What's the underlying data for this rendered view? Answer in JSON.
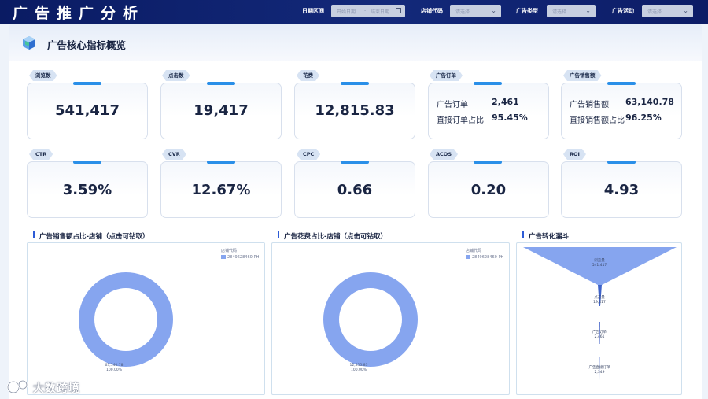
{
  "app_title": "广告推广分析",
  "filters": {
    "date_label": "日期区间",
    "date_start_placeholder": "开始日期",
    "date_sep": "-",
    "date_end_placeholder": "结束日期",
    "shop_label": "店铺代码",
    "shop_placeholder": "请选择",
    "adtype_label": "广告类型",
    "adtype_placeholder": "请选择",
    "campaign_label": "广告活动",
    "campaign_placeholder": "请选择"
  },
  "section_title": "广告核心指标概览",
  "kpis": [
    {
      "label": "浏览数",
      "value": "541,417"
    },
    {
      "label": "点击数",
      "value": "19,417"
    },
    {
      "label": "花费",
      "value": "12,815.83"
    },
    {
      "label": "CTR",
      "value": "3.59%"
    },
    {
      "label": "CVR",
      "value": "12.67%"
    },
    {
      "label": "CPC",
      "value": "0.66"
    },
    {
      "label": "ACOS",
      "value": "0.20"
    },
    {
      "label": "ROI",
      "value": "4.93"
    }
  ],
  "orders_card": {
    "tag": "广告订单",
    "row1_label": "广告订单",
    "row1_value": "2,461",
    "row2_label": "直接订单占比",
    "row2_value": "95.45%"
  },
  "sales_card": {
    "tag": "广告销售额",
    "row1_label": "广告销售额",
    "row1_value": "63,140.78",
    "row2_label": "直接销售额占比",
    "row2_value": "96.25%"
  },
  "charts": {
    "sales_share_title": "广告销售额占比-店铺（点击可钻取）",
    "spend_share_title": "广告花费占比-店铺（点击可钻取）",
    "funnel_title": "广告转化漏斗",
    "legend_title": "店铺代码",
    "legend_item": "2849628460-PH",
    "ring_color": "#86a5ef"
  },
  "chart_data": [
    {
      "type": "pie",
      "title": "广告销售额占比-店铺（点击可钻取）",
      "legend_title": "店铺代码",
      "categories": [
        "2849628460-PH"
      ],
      "values": [
        63140.78
      ],
      "value_label": "63,140.78",
      "percent_label": "100.00%"
    },
    {
      "type": "pie",
      "title": "广告花费占比-店铺（点击可钻取）",
      "legend_title": "店铺代码",
      "categories": [
        "2849628460-PH"
      ],
      "values": [
        12815.83
      ],
      "value_label": "12,815.83",
      "percent_label": "100.00%"
    },
    {
      "type": "funnel",
      "title": "广告转化漏斗",
      "stages": [
        {
          "name": "浏览量",
          "value": 541417,
          "label": "541,417"
        },
        {
          "name": "点击量",
          "value": 19417,
          "label": "19,417"
        },
        {
          "name": "广告订单",
          "value": 2461,
          "label": "2,461"
        },
        {
          "name": "广告直接订单",
          "value": 2349,
          "label": "2,349"
        }
      ]
    }
  ],
  "watermark": "大数跨境"
}
